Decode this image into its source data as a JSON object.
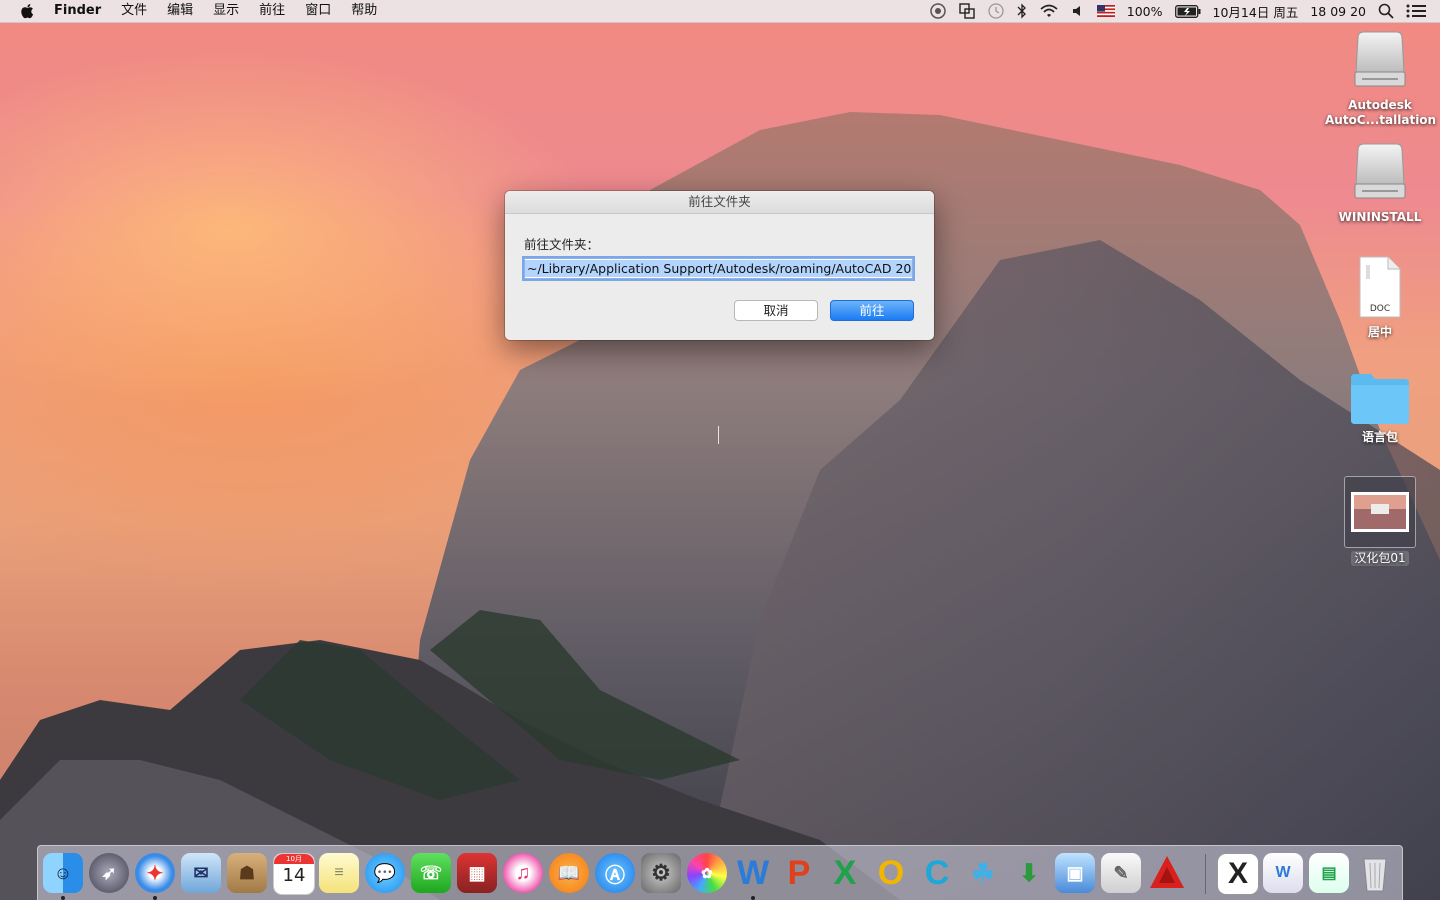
{
  "menubar": {
    "apple_icon": "apple-logo-icon",
    "app_name": "Finder",
    "items": [
      "文件",
      "编辑",
      "显示",
      "前往",
      "窗口",
      "帮助"
    ],
    "battery_percent": "100%",
    "date": "10月14日 周五",
    "time": "18 09 20",
    "status_icons": [
      "sync-icon",
      "mirror-icon",
      "time-machine-icon",
      "bluetooth-icon",
      "wifi-icon",
      "volume-icon",
      "us-flag-icon",
      "battery-icon",
      "spotlight-icon",
      "notification-center-icon"
    ]
  },
  "dialog": {
    "title": "前往文件夹",
    "prompt": "前往文件夹：",
    "path_value": "~/Library/Application Support/Autodesk/roaming/AutoCAD 20",
    "cancel_label": "取消",
    "go_label": "前往"
  },
  "desktop": {
    "icons": [
      {
        "label": "Autodesk AutoC...tallation",
        "line1": "Autodesk",
        "line2": "AutoC...tallation",
        "type": "disk-image-icon"
      },
      {
        "label": "WININSTALL",
        "type": "disk-image-icon"
      },
      {
        "label": "居中",
        "badge": "DOC",
        "type": "document-icon"
      },
      {
        "label": "语言包",
        "type": "folder-icon"
      },
      {
        "label": "汉化包01",
        "type": "screenshot-thumbnail-icon"
      }
    ]
  },
  "dock": {
    "calendar_month": "10月",
    "calendar_day": "14",
    "apps": [
      "finder",
      "launchpad",
      "safari",
      "mail",
      "contacts",
      "calendar",
      "notes",
      "messages",
      "facetime",
      "photo-booth",
      "itunes",
      "ibooks",
      "app-store",
      "system-preferences",
      "photos",
      "word",
      "powerpoint",
      "excel",
      "outlook",
      "app-c",
      "app-people",
      "app-globe",
      "app-screen-share",
      "app-textedit",
      "autocad",
      "app-x",
      "window-1",
      "window-2",
      "trash"
    ]
  },
  "colors": {
    "accent_blue": "#1b7cf4",
    "selection_blue": "#b3d4fd"
  }
}
